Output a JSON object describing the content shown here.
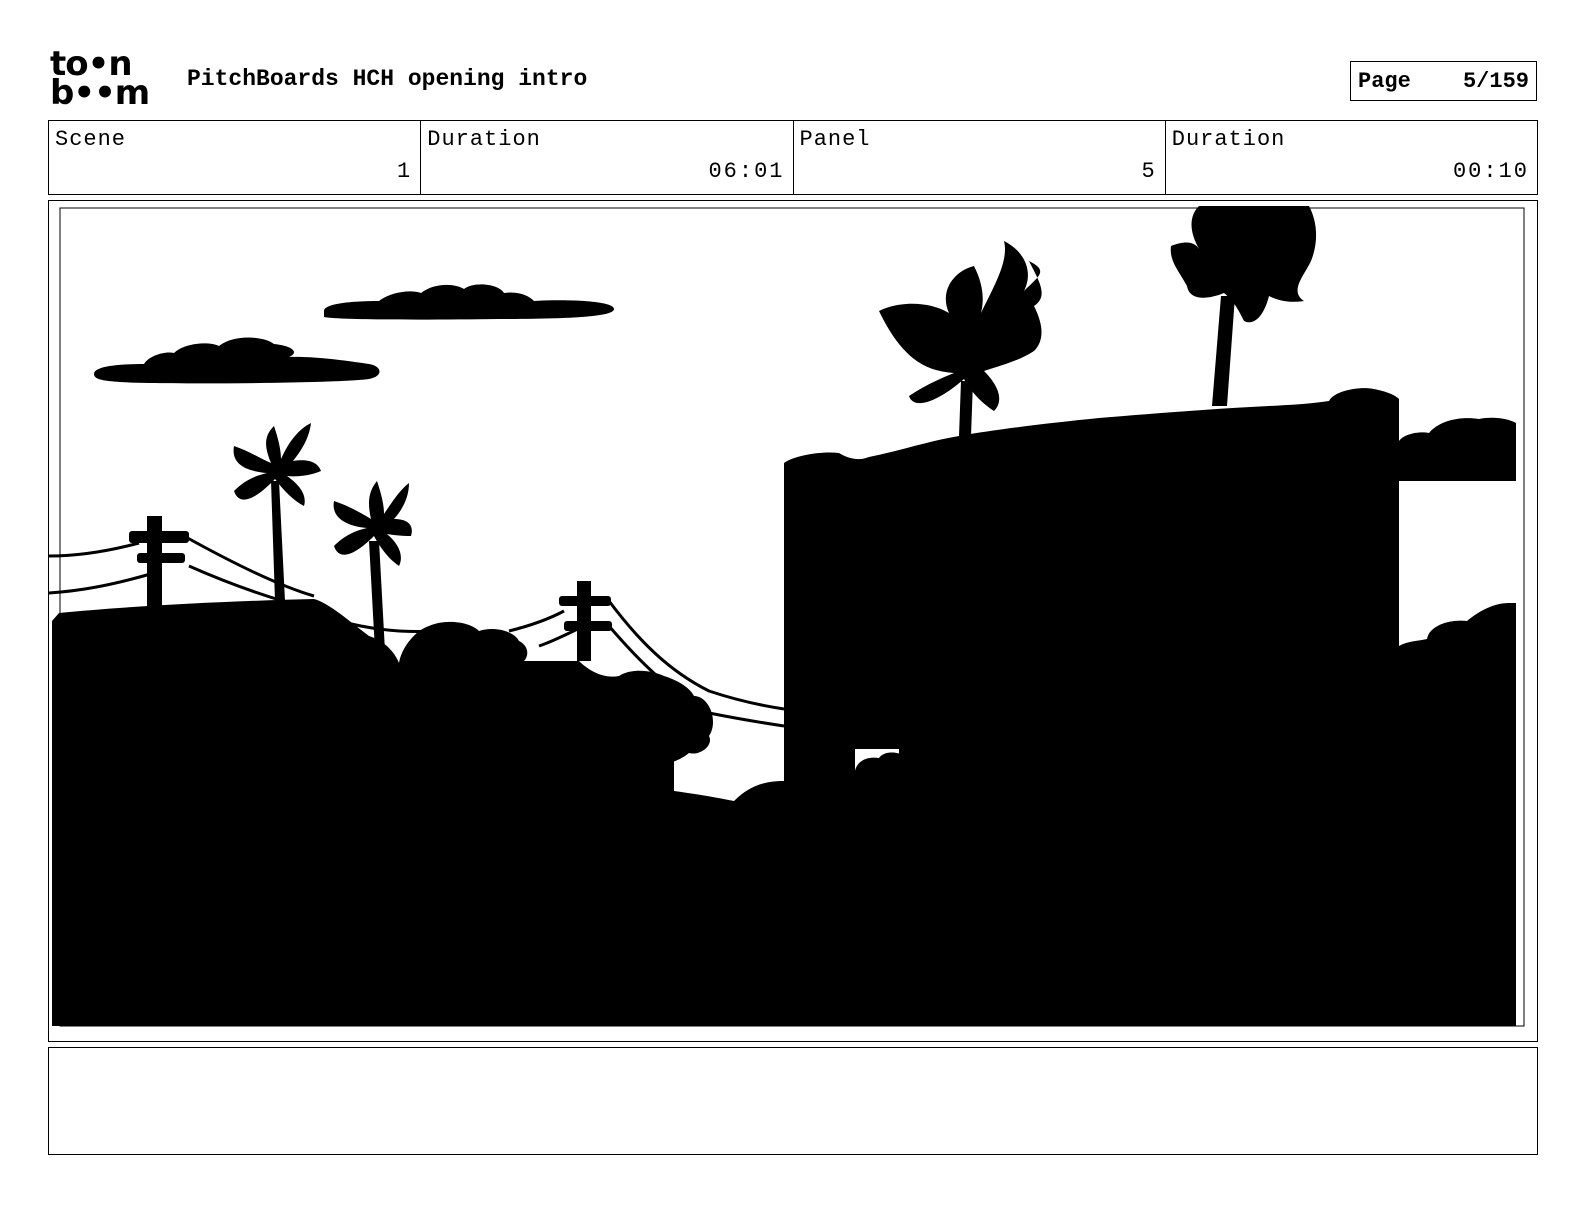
{
  "header": {
    "logo_text_top": "to•n",
    "logo_text_bottom": "b••m",
    "title": "PitchBoards HCH opening intro",
    "page_label": "Page",
    "page_value": "5/159"
  },
  "info": {
    "scene_label": "Scene",
    "scene_value": "1",
    "scene_duration_label": "Duration",
    "scene_duration_value": "06:01",
    "panel_label": "Panel",
    "panel_value": "5",
    "panel_duration_label": "Duration",
    "panel_duration_value": "00:10"
  },
  "panel": {
    "content": "silhouette-cityscape-drawing"
  },
  "notes": {
    "text": ""
  },
  "colors": {
    "ink": "#000000",
    "paper": "#ffffff"
  }
}
